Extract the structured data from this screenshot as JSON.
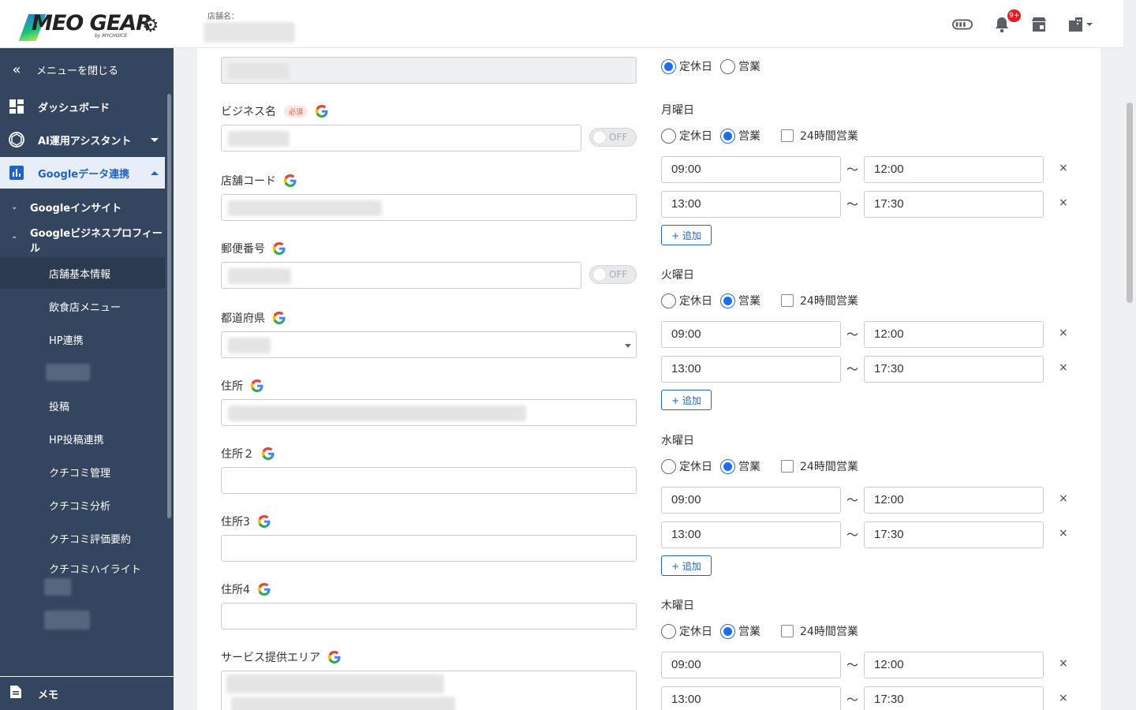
{
  "header": {
    "logo_text": "MEO GEAR",
    "logo_sub": "by MYCHOICE",
    "store_label": "店舗名：",
    "notification_badge": "9+"
  },
  "sidebar": {
    "close_menu": "メニューを閉じる",
    "dashboard": "ダッシュボード",
    "ai_assistant": "AI運用アシスタント",
    "google_data": "Googleデータ連携",
    "google_insight": "Googleインサイト",
    "google_business_profile": "Googleビジネスプロフィール",
    "leaf_items": [
      "店舗基本情報",
      "飲食店メニュー",
      "HP連携",
      "投稿",
      "HP投稿連携",
      "クチコミ管理",
      "クチコミ分析",
      "クチコミ評価要約",
      "クチコミハイライト"
    ],
    "memo": "メモ"
  },
  "form": {
    "business_name_label": "ビジネス名",
    "required_badge": "必須",
    "store_code_label": "店舗コード",
    "postal_code_label": "郵便番号",
    "prefecture_label": "都道府県",
    "address_label": "住所",
    "address2_label": "住所２",
    "address3_label": "住所3",
    "address4_label": "住所4",
    "service_area_label": "サービス提供エリア",
    "toggle_off": "OFF"
  },
  "hours": {
    "closed": "定休日",
    "open": "営業",
    "all_day": "24時間営業",
    "add": "+ 追加",
    "tilde": "〜",
    "remove": "×",
    "top_row_state": "closed",
    "days": [
      {
        "name": "月曜日",
        "state": "open",
        "slots": [
          [
            "09:00",
            "12:00"
          ],
          [
            "13:00",
            "17:30"
          ]
        ]
      },
      {
        "name": "火曜日",
        "state": "open",
        "slots": [
          [
            "09:00",
            "12:00"
          ],
          [
            "13:00",
            "17:30"
          ]
        ]
      },
      {
        "name": "水曜日",
        "state": "open",
        "slots": [
          [
            "09:00",
            "12:00"
          ],
          [
            "13:00",
            "17:30"
          ]
        ]
      },
      {
        "name": "木曜日",
        "state": "open",
        "slots": [
          [
            "09:00",
            "12:00"
          ],
          [
            "13:00",
            "17:30"
          ]
        ]
      }
    ]
  }
}
